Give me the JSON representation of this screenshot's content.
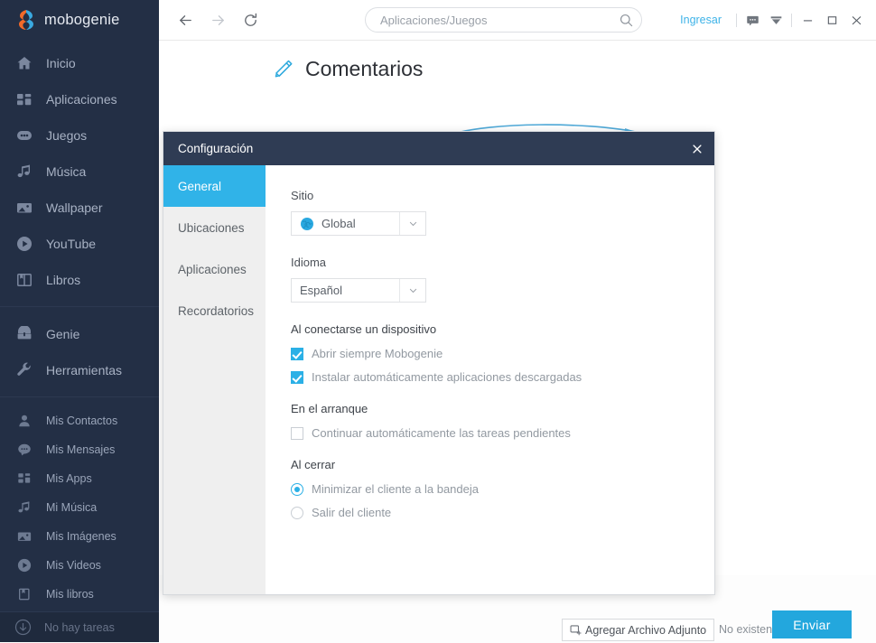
{
  "app": {
    "brand_name": "mobogenie",
    "brand_logo_icon": "mobogenie-logo-icon"
  },
  "sidebar": {
    "primary_items": [
      {
        "label": "Inicio",
        "icon": "home-icon"
      },
      {
        "label": "Aplicaciones",
        "icon": "apps-grid-icon"
      },
      {
        "label": "Juegos",
        "icon": "gamepad-icon"
      },
      {
        "label": "Música",
        "icon": "music-note-icon"
      },
      {
        "label": "Wallpaper",
        "icon": "image-icon"
      },
      {
        "label": "YouTube",
        "icon": "play-circle-icon"
      },
      {
        "label": "Libros",
        "icon": "book-icon"
      }
    ],
    "tools_items": [
      {
        "label": "Genie",
        "icon": "treasure-chest-icon"
      },
      {
        "label": "Herramientas",
        "icon": "wrench-icon"
      }
    ],
    "my_items": [
      {
        "label": "Mis Contactos",
        "icon": "person-icon"
      },
      {
        "label": "Mis Mensajes",
        "icon": "chat-bubble-icon"
      },
      {
        "label": "Mis Apps",
        "icon": "apps-grid-icon"
      },
      {
        "label": "Mi Música",
        "icon": "music-note-icon"
      },
      {
        "label": "Mis Imágenes",
        "icon": "image-icon"
      },
      {
        "label": "Mis Videos",
        "icon": "play-circle-icon"
      },
      {
        "label": "Mis libros",
        "icon": "book-icon"
      }
    ],
    "tasks": {
      "label": "No hay tareas",
      "icon": "download-circle-icon"
    }
  },
  "topbar": {
    "back_icon": "arrow-left-icon",
    "forward_icon": "arrow-right-icon",
    "reload_icon": "reload-icon",
    "search": {
      "value": "",
      "placeholder": "Aplicaciones/Juegos",
      "icon": "search-icon"
    },
    "login_label": "Ingresar",
    "feedback_icon": "chat-bubble-icon",
    "dropdown_icon": "chevron-down-filled-icon",
    "minimize_icon": "minimize-icon",
    "maximize_icon": "maximize-icon",
    "close_icon": "close-icon"
  },
  "page": {
    "title": "Comentarios",
    "title_icon": "pencil-icon",
    "attach_button": "Agregar Archivo Adjunto",
    "attach_icon": "add-attachment-icon",
    "no_files_text": "No existen",
    "send_button": "Enviar"
  },
  "modal": {
    "title": "Configuración",
    "close_icon": "close-icon",
    "tabs": [
      {
        "label": "General",
        "active": true
      },
      {
        "label": "Ubicaciones",
        "active": false
      },
      {
        "label": "Aplicaciones",
        "active": false
      },
      {
        "label": "Recordatorios",
        "active": false
      }
    ],
    "site": {
      "label": "Sitio",
      "value": "Global",
      "icon": "globe-icon",
      "caret_icon": "chevron-down-icon"
    },
    "language": {
      "label": "Idioma",
      "value": "Español",
      "caret_icon": "chevron-down-icon"
    },
    "on_connect": {
      "heading": "Al conectarse un dispositivo",
      "options": [
        {
          "label": "Abrir siempre Mobogenie",
          "checked": true
        },
        {
          "label": "Instalar automáticamente aplicaciones descargadas",
          "checked": true
        }
      ]
    },
    "on_startup": {
      "heading": "En el arranque",
      "options": [
        {
          "label": "Continuar automáticamente las tareas pendientes",
          "checked": false
        }
      ]
    },
    "on_close": {
      "heading": "Al cerrar",
      "options": [
        {
          "label": "Minimizar el cliente a la bandeja",
          "checked": true
        },
        {
          "label": "Salir del cliente",
          "checked": false
        }
      ]
    }
  },
  "colors": {
    "sidebar_bg": "#232f45",
    "modal_header_bg": "#2f3c54",
    "accent": "#30b3e8",
    "send_button_bg": "#23a7dd",
    "link": "#3eb3e8"
  }
}
